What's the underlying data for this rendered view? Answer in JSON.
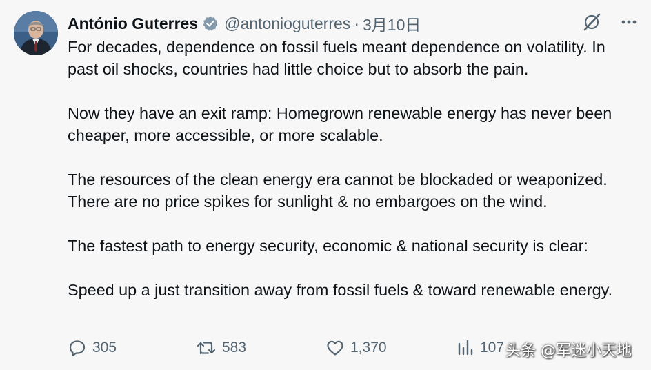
{
  "author": {
    "name": "António Guterres",
    "handle": "@antonioguterres",
    "separator": "·",
    "date": "3月10日",
    "verified": true
  },
  "icons": {
    "avatar": "avatar-portrait",
    "verified": "verified-badge-icon",
    "grok": "grok-icon",
    "more": "more-icon",
    "reply": "reply-icon",
    "retweet": "retweet-icon",
    "like": "like-icon",
    "views": "views-icon"
  },
  "paragraphs": [
    "For decades, dependence on fossil fuels meant dependence on volatility. In past oil shocks, countries had little choice but to absorb the pain.",
    "Now they have an exit ramp: Homegrown renewable energy has never been cheaper, more accessible, or more scalable.",
    "The resources of the clean energy era cannot be blockaded or weaponized. There are no price spikes for sunlight & no embargoes on the wind.",
    "The fastest path to energy security, economic & national security is clear:",
    "Speed up a just transition away from fossil fuels & toward renewable energy."
  ],
  "stats": {
    "replies": "305",
    "retweets": "583",
    "likes": "1,370",
    "views": "107"
  },
  "watermark": "头条 @军迷小天地",
  "colors": {
    "text": "#0f1419",
    "secondary": "#536471",
    "background": "#f7f7f7"
  }
}
